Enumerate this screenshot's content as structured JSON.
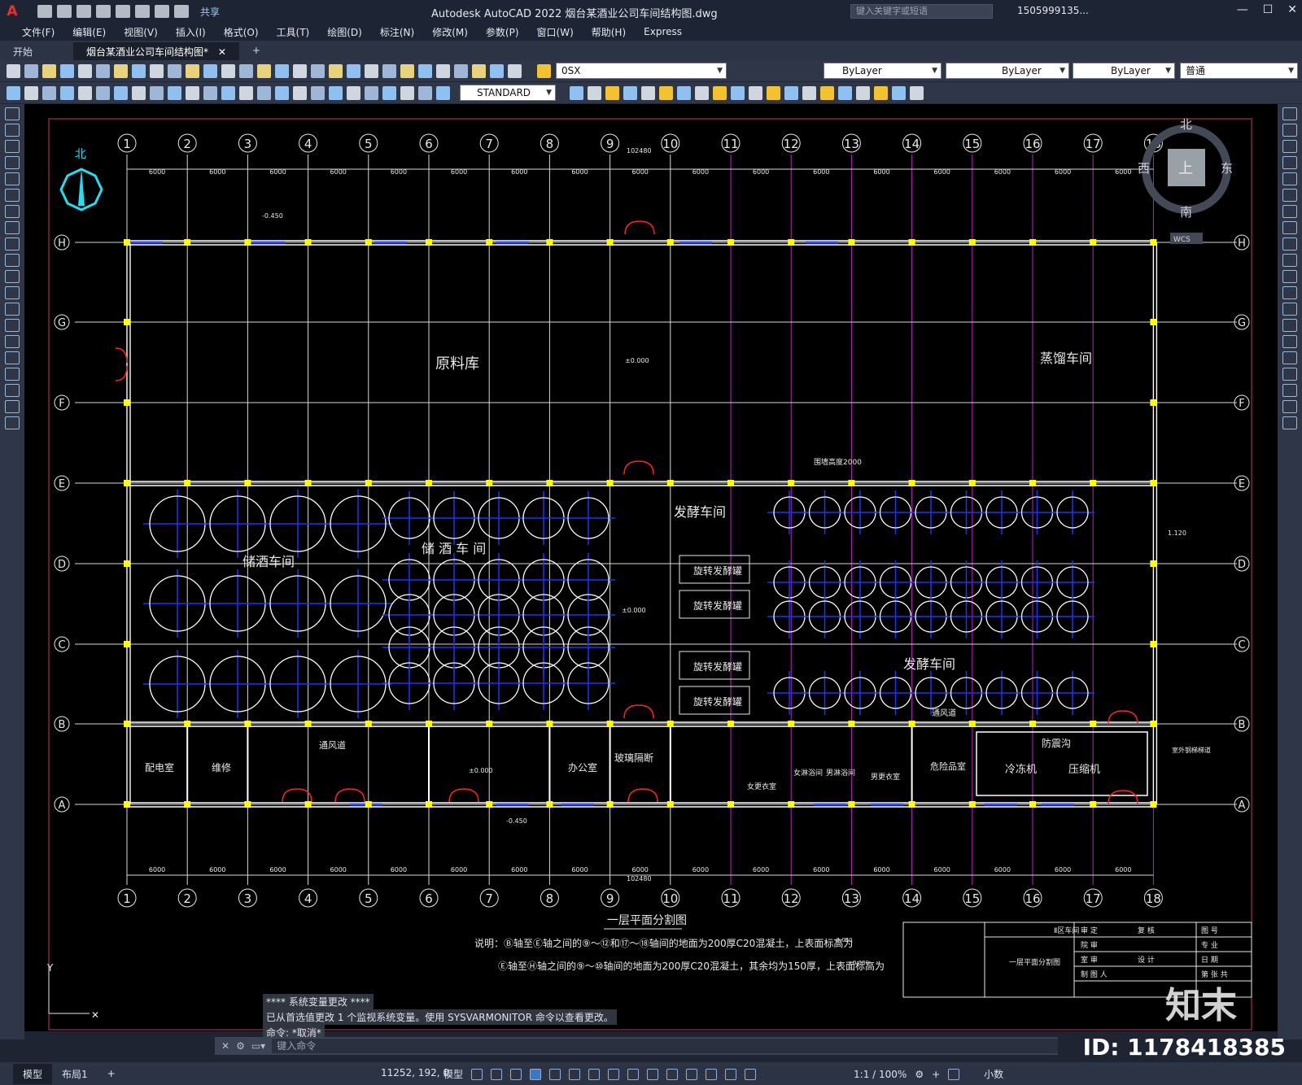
{
  "titlebar": {
    "app_title": "Autodesk AutoCAD 2022    烟台某酒业公司车间结构图.dwg",
    "share_label": "共享",
    "search_placeholder": "键入关键字或短语",
    "user_label": "1505999135...",
    "window_controls": [
      "—",
      "☐",
      "✕"
    ]
  },
  "menubar": {
    "items": [
      "文件(F)",
      "编辑(E)",
      "视图(V)",
      "插入(I)",
      "格式(O)",
      "工具(T)",
      "绘图(D)",
      "标注(N)",
      "修改(M)",
      "参数(P)",
      "窗口(W)",
      "帮助(H)",
      "Express"
    ]
  },
  "tabs": {
    "items": [
      {
        "label": "开始",
        "active": false
      },
      {
        "label": "烟台某酒业公司车间结构图*",
        "active": true
      }
    ],
    "add_label": "+"
  },
  "toolbar1": {
    "layer_value": "0SX",
    "color_value": "ByLayer",
    "linetype_value": "ByLayer",
    "lineweight_value": "ByLayer",
    "plotstyle_value": "普通"
  },
  "toolbar2": {
    "textstyle_value": "STANDARD"
  },
  "viewcube": {
    "north": "北",
    "south": "南",
    "east": "东",
    "west": "西",
    "top": "上",
    "wcs": "WCS"
  },
  "drawing": {
    "grid_numbers": [
      "1",
      "2",
      "3",
      "4",
      "5",
      "6",
      "7",
      "8",
      "9",
      "10",
      "11",
      "12",
      "13",
      "14",
      "15",
      "16",
      "17",
      "18"
    ],
    "grid_letters": [
      "H",
      "G",
      "F",
      "E",
      "D",
      "C",
      "B",
      "A"
    ],
    "rooms": {
      "raw_material": "原料库",
      "distillation": "蒸馏车间",
      "fermentation_top": "发酵车间",
      "storage_left": "储酒车间",
      "storage_right": "储 酒 车 间",
      "fermentation_right": "发酵车间",
      "tank1": "旋转发酵罐",
      "tank2": "旋转发酵罐",
      "tank3": "旋转发酵罐",
      "tank4": "旋转发酵罐",
      "power": "配电室",
      "repair": "维修",
      "vent1": "通风道",
      "office": "办公室",
      "glass": "玻璃隔断",
      "female_change": "女更衣室",
      "female_shower": "女淋浴间",
      "male_shower": "男淋浴间",
      "male_change": "男更衣室",
      "vent2": "通风道",
      "hazard": "危险品室",
      "cooler": "冷冻机",
      "compressor": "压缩机",
      "fireproof": "防震沟",
      "stair_note": "室外钢梯梯道",
      "wall_height": "围墙高度2000"
    },
    "dims": {
      "total_top": "102480",
      "total_bottom": "102480",
      "bay": "6000",
      "elev_0": "±0.000",
      "elev_neg": "-0.450",
      "elev_1120": "1.120"
    },
    "drawing_title": "一层平面分割图",
    "notes": [
      "说明：Ⓑ轴至Ⓔ轴之间的⑨～⑫和⑰～⑱轴间的地面为200厚C20混凝土，上表面标高为",
      "Ⓔ轴至Ⓗ轴之间的⑨～⑩轴间的地面为200厚C20混凝土，其余均为150厚，上表面标高为"
    ],
    "note_elev_1": "-0.050",
    "note_elev_2": "±0.000",
    "titleblock": {
      "project": "Ⅱ区车间",
      "sheet": "一层平面分割图",
      "labels": [
        "审 定",
        "院 审",
        "室 审",
        "制 图 人",
        "复 核",
        "设 计"
      ],
      "right_labels": [
        "图 号",
        "专 业",
        "日 期",
        "第 张 共"
      ]
    }
  },
  "command": {
    "history": [
      "**** 系统变量更改 ****",
      "已从首选值更改 1 个监视系统变量。使用 SYSVARMONITOR 命令以查看更改。",
      "命令: *取消*"
    ],
    "input_placeholder": "键入命令"
  },
  "statusbar": {
    "tabs": [
      "模型",
      "布局1"
    ],
    "add_label": "+",
    "coords": "11252, 192, 0",
    "model_label": "模型",
    "scale": "1:1 / 100%",
    "units": "小数"
  },
  "overlay": {
    "brand": "知末",
    "id_label": "ID: 1178418385"
  }
}
